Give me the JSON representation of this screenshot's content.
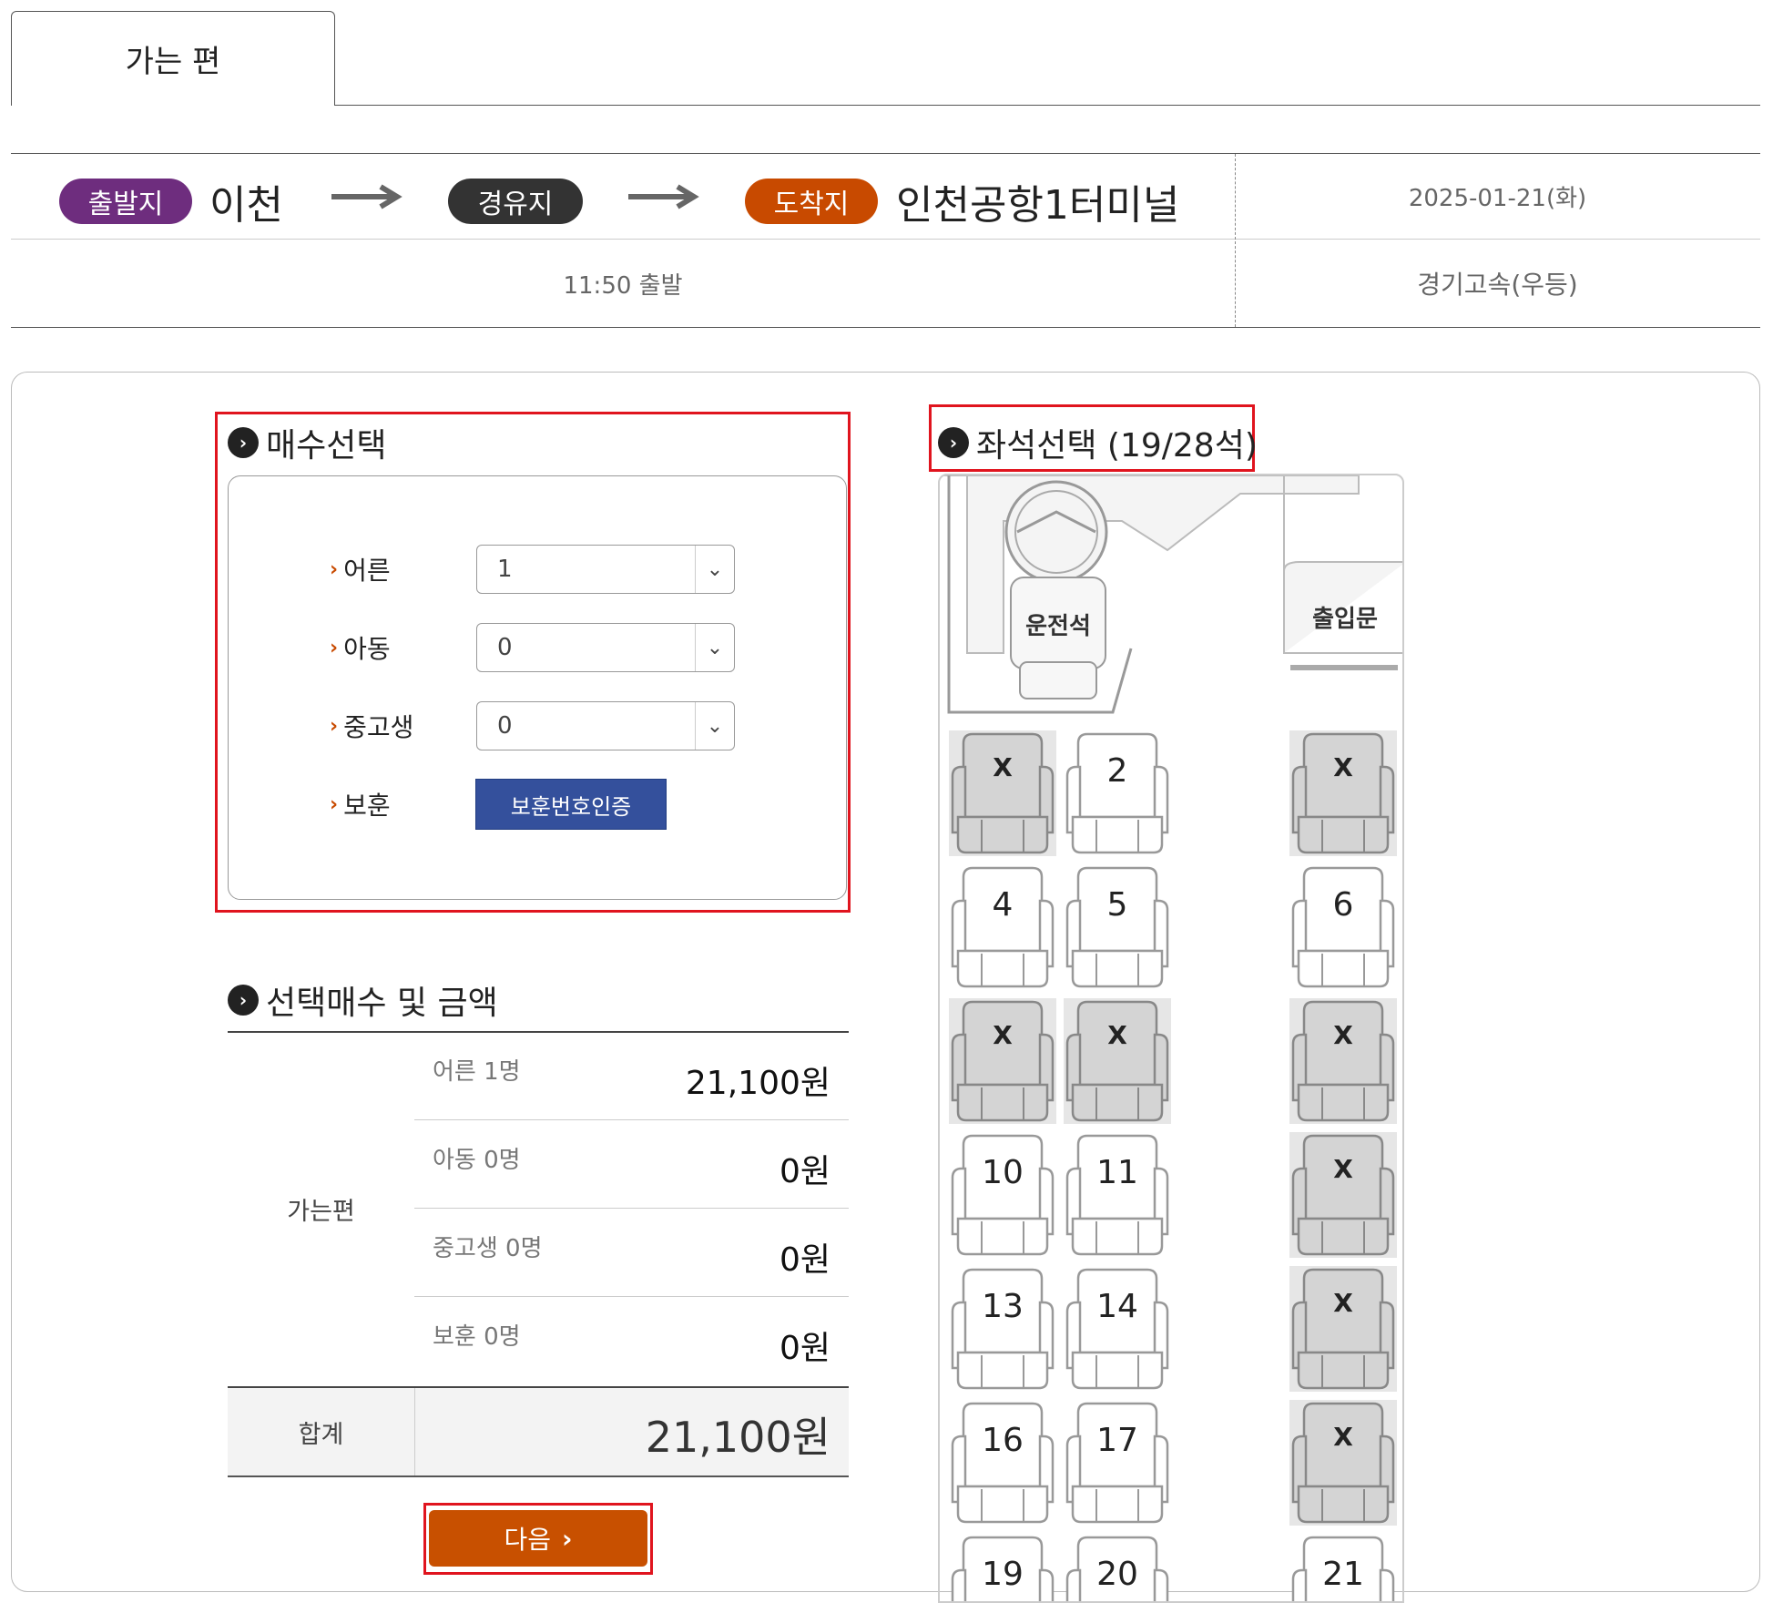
{
  "tab": {
    "label": "가는 편"
  },
  "route": {
    "origin_badge": "출발지",
    "origin": "이천",
    "via_badge": "경유지",
    "dest_badge": "도착지",
    "destination": "인천공항1터미널",
    "date": "2025-01-21(화)",
    "departure": "11:50 출발",
    "company": "경기고속(우등)",
    "colors": {
      "origin": "#6e2d7e",
      "via": "#333333",
      "dest": "#c84a00"
    }
  },
  "ticket_select": {
    "title": "매수선택",
    "rows": [
      {
        "label": "어른",
        "value": "1"
      },
      {
        "label": "아동",
        "value": "0"
      },
      {
        "label": "중고생",
        "value": "0"
      }
    ],
    "veteran_label": "보훈",
    "veteran_button": "보훈번호인증"
  },
  "summary": {
    "title": "선택매수 및 금액",
    "group_label": "가는편",
    "rows": [
      {
        "label": "어른 1명",
        "amount": "21,100원"
      },
      {
        "label": "아동 0명",
        "amount": "0원"
      },
      {
        "label": "중고생 0명",
        "amount": "0원"
      },
      {
        "label": "보훈 0명",
        "amount": "0원"
      }
    ],
    "total_label": "합계",
    "total_amount": "21,100원"
  },
  "next_button": "다음",
  "seat_select": {
    "title": "좌석선택 (19/28석)",
    "driver_label": "운전석",
    "door_label": "출입문",
    "seats": [
      {
        "label": "X",
        "taken": true
      },
      {
        "label": "2",
        "taken": false
      },
      {
        "label": "X",
        "taken": true
      },
      {
        "label": "4",
        "taken": false
      },
      {
        "label": "5",
        "taken": false
      },
      {
        "label": "6",
        "taken": false
      },
      {
        "label": "X",
        "taken": true
      },
      {
        "label": "X",
        "taken": true
      },
      {
        "label": "X",
        "taken": true
      },
      {
        "label": "10",
        "taken": false
      },
      {
        "label": "11",
        "taken": false
      },
      {
        "label": "X",
        "taken": true
      },
      {
        "label": "13",
        "taken": false
      },
      {
        "label": "14",
        "taken": false
      },
      {
        "label": "X",
        "taken": true
      },
      {
        "label": "16",
        "taken": false
      },
      {
        "label": "17",
        "taken": false
      },
      {
        "label": "X",
        "taken": true
      },
      {
        "label": "19",
        "taken": false
      },
      {
        "label": "20",
        "taken": false
      },
      {
        "label": "21",
        "taken": false
      }
    ]
  }
}
